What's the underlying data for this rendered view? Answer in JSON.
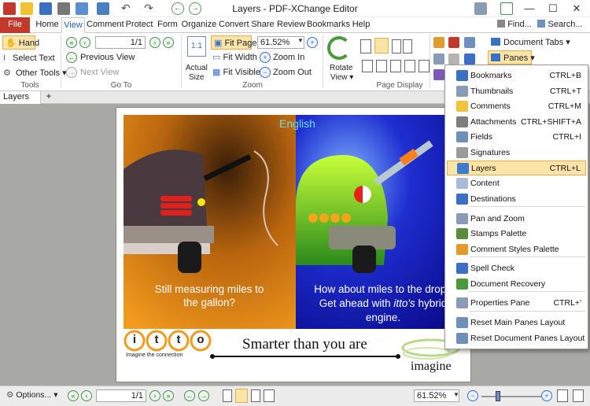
{
  "window": {
    "title": "Layers - PDF-XChange Editor",
    "find_label": "Find...",
    "search_label": "Search...",
    "minimize": "—",
    "maximize": "☐",
    "close": "✕"
  },
  "tabs": [
    "File",
    "Home",
    "View",
    "Comment",
    "Protect",
    "Form",
    "Organize",
    "Convert",
    "Share",
    "Review",
    "Bookmarks",
    "Help"
  ],
  "ribbon": {
    "tools": {
      "hand": "Hand",
      "select_text": "Select Text",
      "other_tools": "Other Tools",
      "group": "Tools"
    },
    "goto": {
      "page_value": "1/1",
      "previous_view": "Previous View",
      "next_view": "Next View",
      "group": "Go To"
    },
    "zoom": {
      "actual_size_line1": "Actual",
      "actual_size_line2": "Size",
      "fit_page": "Fit Page",
      "fit_width": "Fit Width",
      "fit_visible": "Fit Visible",
      "zoom_value": "61.52%",
      "zoom_in": "Zoom In",
      "zoom_out": "Zoom Out",
      "group": "Zoom"
    },
    "page_display": {
      "rotate_line1": "Rotate",
      "rotate_line2": "View",
      "group": "Page Display"
    },
    "document_tabs": "Document Tabs",
    "panes": "Panes"
  },
  "doc_tab": {
    "label": "Layers",
    "add": "+"
  },
  "document": {
    "heading": "English",
    "left_caption_l1": "Still measuring miles to",
    "left_caption_l2": "the gallon?",
    "right_caption_l1": "How about miles to the drop?",
    "right_caption_l2_pre": "Get ahead with ",
    "right_caption_l2_it": "itto's",
    "right_caption_l2_post": " hybrid",
    "right_caption_l3": "engine.",
    "logo_letters": [
      "i",
      "t",
      "t",
      "o"
    ],
    "tagline": "Imagine the connection",
    "slogan": "Smarter than you are",
    "imagine": "imagine"
  },
  "panes_menu": [
    {
      "label": "Bookmarks",
      "shortcut": "CTRL+B",
      "icon": "bookmarks-icon",
      "color": "#3a6fc4"
    },
    {
      "label": "Thumbnails",
      "shortcut": "CTRL+T",
      "icon": "thumbnails-icon",
      "color": "#8a9bb5"
    },
    {
      "label": "Comments",
      "shortcut": "CTRL+M",
      "icon": "comments-icon",
      "color": "#f2c43d"
    },
    {
      "label": "Attachments",
      "shortcut": "CTRL+SHIFT+A",
      "icon": "attachments-icon",
      "color": "#7d7d7d"
    },
    {
      "label": "Fields",
      "shortcut": "CTRL+I",
      "icon": "fields-icon",
      "color": "#6d8fb8"
    },
    {
      "label": "Signatures",
      "shortcut": "",
      "icon": "signatures-icon",
      "color": "#9a9a9a"
    },
    {
      "label": "Layers",
      "shortcut": "CTRL+L",
      "icon": "layers-icon",
      "color": "#3d7bd0"
    },
    {
      "label": "Content",
      "shortcut": "",
      "icon": "content-icon",
      "color": "#a9bcd6"
    },
    {
      "label": "Destinations",
      "shortcut": "",
      "icon": "destinations-icon",
      "color": "#3a6fc4"
    },
    {
      "label": "Pan and Zoom",
      "shortcut": "",
      "icon": "pan-zoom-icon",
      "color": "#8a9bb5"
    },
    {
      "label": "Stamps Palette",
      "shortcut": "",
      "icon": "stamps-icon",
      "color": "#5a8d3c"
    },
    {
      "label": "Comment Styles Palette",
      "shortcut": "",
      "icon": "comment-styles-icon",
      "color": "#e29a2b"
    },
    {
      "label": "Spell Check",
      "shortcut": "",
      "icon": "spell-check-icon",
      "color": "#3a6fc4"
    },
    {
      "label": "Document Recovery",
      "shortcut": "",
      "icon": "document-recovery-icon",
      "color": "#4a9a3c"
    },
    {
      "label": "Properties Pane",
      "shortcut": "CTRL+'",
      "icon": "properties-icon",
      "color": "#8a9bb5"
    },
    {
      "label": "Reset Main Panes Layout",
      "shortcut": "",
      "icon": "reset-main-icon",
      "color": "#6d8fb8"
    },
    {
      "label": "Reset Document Panes Layout",
      "shortcut": "",
      "icon": "reset-doc-icon",
      "color": "#6d8fb8"
    }
  ],
  "statusbar": {
    "options": "Options...",
    "page_value": "1/1",
    "zoom_value": "61.52%"
  },
  "colors": {
    "accent": "#1f5fa8",
    "file_tab": "#c0392b",
    "highlight": "#fbe4a8"
  }
}
